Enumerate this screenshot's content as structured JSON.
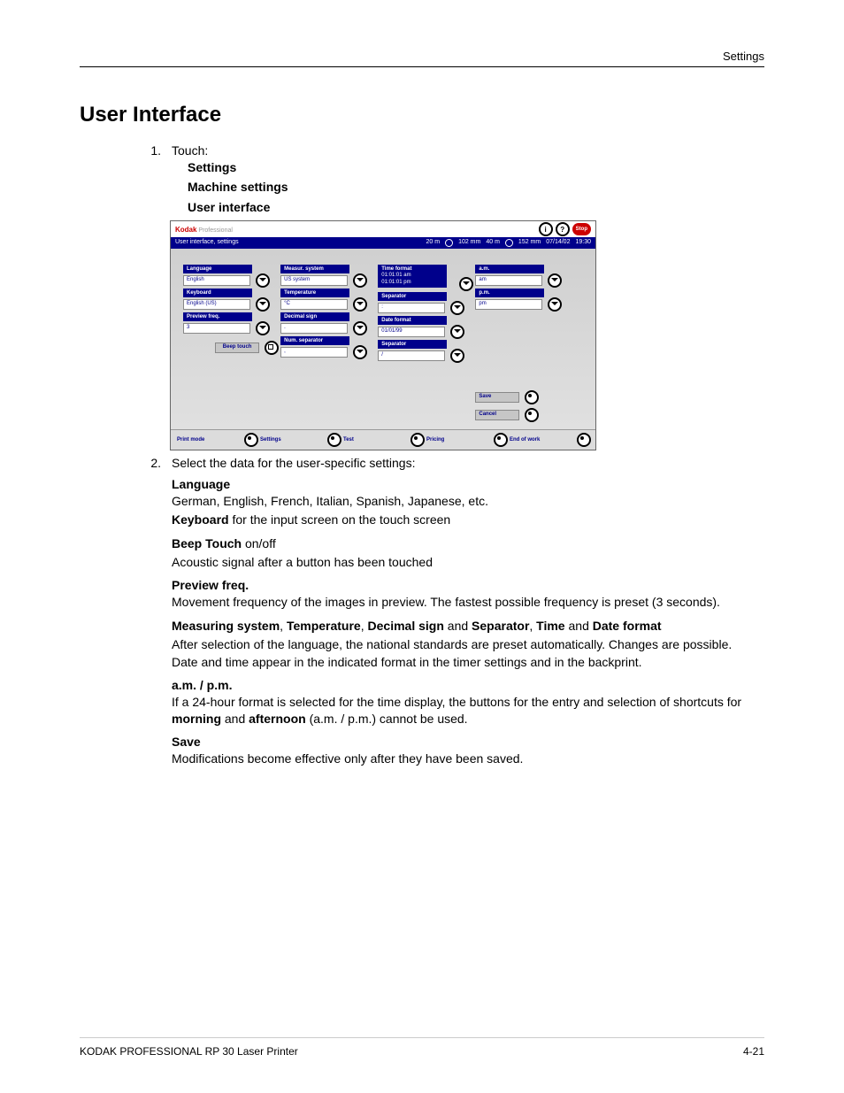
{
  "header": {
    "section": "Settings"
  },
  "title": "User Interface",
  "step1": {
    "num": "1.",
    "prompt": "Touch:",
    "items": [
      "Settings",
      "Machine settings",
      "User interface"
    ]
  },
  "ui": {
    "brand": "Kodak",
    "brand2": " Professional",
    "stop": "Stop",
    "bar_left": "User interface, settings",
    "bar_right": {
      "s1": "20 m",
      "s1b": "102 mm",
      "s2": "40 m",
      "s2b": "152 mm",
      "date": "07/14/02",
      "time": "19:30"
    },
    "col1": {
      "language": {
        "label": "Language",
        "value": "English"
      },
      "keyboard": {
        "label": "Keyboard",
        "value": "English (US)"
      },
      "preview": {
        "label": "Preview freq.",
        "value": "3"
      },
      "beep": {
        "label": "Beep touch"
      }
    },
    "col2": {
      "measure": {
        "label": "Measur. system",
        "value": "US system"
      },
      "temp": {
        "label": "Temperature",
        "value": "°C"
      },
      "decimal": {
        "label": "Decimal sign",
        "value": "."
      },
      "numsep": {
        "label": "Num. separator",
        "value": ","
      }
    },
    "col3": {
      "time": {
        "label": "Time format",
        "value": "01:01:01 am\n01:01:01 pm"
      },
      "sep1": {
        "label": "Separator",
        "value": ":"
      },
      "date": {
        "label": "Date format",
        "value": "01/01/99"
      },
      "sep2": {
        "label": "Separator",
        "value": "/"
      }
    },
    "col4": {
      "am": {
        "label": "a.m.",
        "value": "am"
      },
      "pm": {
        "label": "p.m.",
        "value": "pm"
      }
    },
    "actions": {
      "save": "Save",
      "cancel": "Cancel"
    },
    "footer": {
      "print": "Print mode",
      "settings": "Settings",
      "test": "Test",
      "pricing": "Pricing",
      "end": "End of work"
    }
  },
  "step2": {
    "num": "2.",
    "prompt": "Select the data for the user-specific settings:",
    "language": {
      "h": "Language",
      "p": "German, English, French, Italian, Spanish, Japanese, etc."
    },
    "keyboard": {
      "h": "Keyboard",
      "tail": " for the input screen on the touch screen"
    },
    "beep": {
      "h": "Beep Touch",
      "tail": " on/off",
      "p": "Acoustic signal after a button has been touched"
    },
    "preview": {
      "h": "Preview freq.",
      "p": "Movement frequency of the images in preview. The fastest possible frequency is preset (3 seconds)."
    },
    "formatting": {
      "h1": "Measuring system",
      "c1": ", ",
      "h2": "Temperature",
      "c2": ", ",
      "h3": "Decimal sign",
      "c3": " and ",
      "h4": "Separator",
      "c4": ", ",
      "h5": "Time",
      "c5": " and ",
      "h6": "Date format",
      "p1": "After selection of the language, the national standards are preset automatically. Changes are possible.",
      "p2": "Date and time appear in the indicated format in the timer settings and in the backprint."
    },
    "ampm": {
      "h": "a.m. / p.m.",
      "p1": "If a 24-hour format is selected for the time display, the buttons for the entry and selection of shortcuts for ",
      "b1": "morning",
      "and": " and ",
      "b2": "afternoon",
      "p2": " (a.m. / p.m.) cannot be used."
    },
    "save": {
      "h": "Save",
      "p": "Modifications become effective only after they have been saved."
    }
  },
  "footer": {
    "left": "KODAK PROFESSIONAL RP 30 Laser Printer",
    "right": "4-21"
  }
}
